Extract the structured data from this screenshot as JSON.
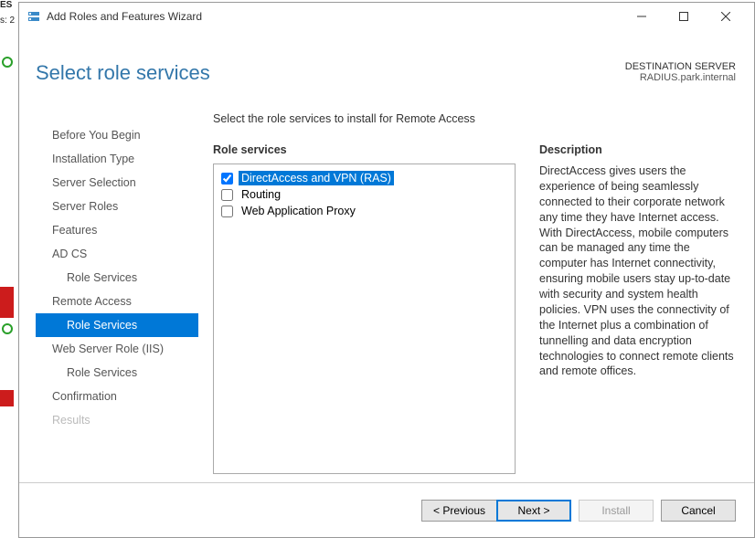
{
  "titlebar": {
    "title": "Add Roles and Features Wizard"
  },
  "header": {
    "page_title": "Select role services",
    "dest_label": "DESTINATION SERVER",
    "dest_value": "RADIUS.park.internal"
  },
  "nav": [
    {
      "label": "Before You Begin",
      "sub": false,
      "active": false,
      "disabled": false
    },
    {
      "label": "Installation Type",
      "sub": false,
      "active": false,
      "disabled": false
    },
    {
      "label": "Server Selection",
      "sub": false,
      "active": false,
      "disabled": false
    },
    {
      "label": "Server Roles",
      "sub": false,
      "active": false,
      "disabled": false
    },
    {
      "label": "Features",
      "sub": false,
      "active": false,
      "disabled": false
    },
    {
      "label": "AD CS",
      "sub": false,
      "active": false,
      "disabled": false
    },
    {
      "label": "Role Services",
      "sub": true,
      "active": false,
      "disabled": false
    },
    {
      "label": "Remote Access",
      "sub": false,
      "active": false,
      "disabled": false
    },
    {
      "label": "Role Services",
      "sub": true,
      "active": true,
      "disabled": false
    },
    {
      "label": "Web Server Role (IIS)",
      "sub": false,
      "active": false,
      "disabled": false
    },
    {
      "label": "Role Services",
      "sub": true,
      "active": false,
      "disabled": false
    },
    {
      "label": "Confirmation",
      "sub": false,
      "active": false,
      "disabled": false
    },
    {
      "label": "Results",
      "sub": false,
      "active": false,
      "disabled": true
    }
  ],
  "main": {
    "instruction": "Select the role services to install for Remote Access",
    "roles_header": "Role services",
    "roles": [
      {
        "label": "DirectAccess and VPN (RAS)",
        "checked": true,
        "selected": true
      },
      {
        "label": "Routing",
        "checked": false,
        "selected": false
      },
      {
        "label": "Web Application Proxy",
        "checked": false,
        "selected": false
      }
    ],
    "desc_header": "Description",
    "desc_text": "DirectAccess gives users the experience of being seamlessly connected to their corporate network any time they have Internet access. With DirectAccess, mobile computers can be managed any time the computer has Internet connectivity, ensuring mobile users stay up-to-date with security and system health policies. VPN uses the connectivity of the Internet plus a combination of tunnelling and data encryption technologies to connect remote clients and remote offices."
  },
  "footer": {
    "previous": "< Previous",
    "next": "Next >",
    "install": "Install",
    "cancel": "Cancel"
  },
  "left_frag": {
    "t1": "ES",
    "t2": "s: 2"
  }
}
